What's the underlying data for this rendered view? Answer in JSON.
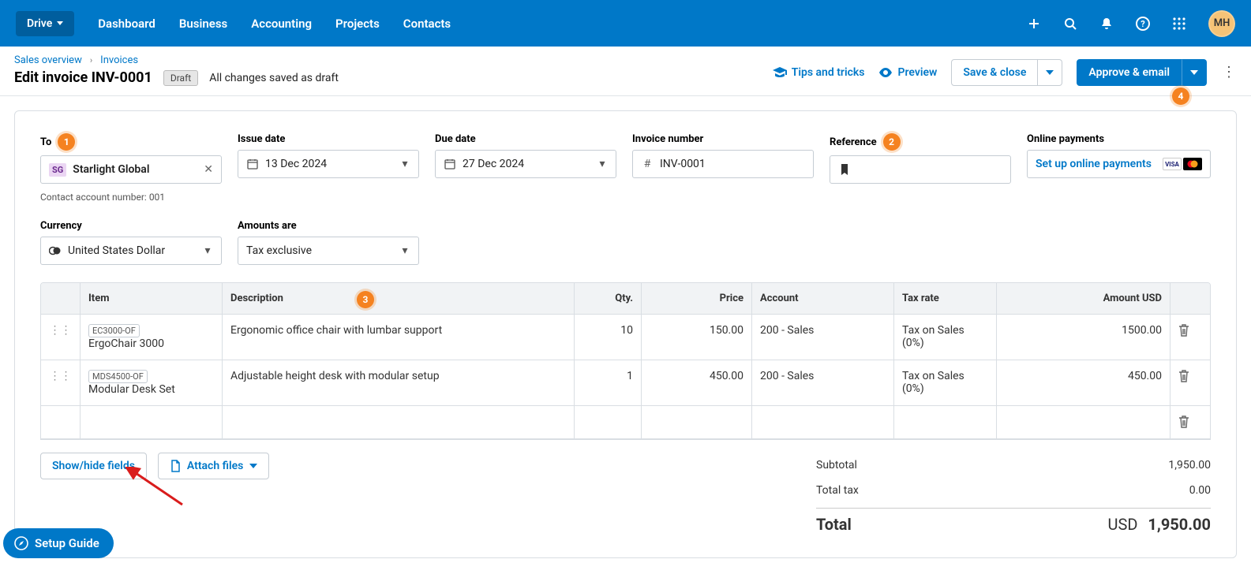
{
  "top": {
    "org": "Drive",
    "nav": [
      "Dashboard",
      "Business",
      "Accounting",
      "Projects",
      "Contacts"
    ],
    "avatar_initials": "MH"
  },
  "breadcrumb": {
    "a": "Sales overview",
    "b": "Invoices"
  },
  "page_title": "Edit invoice INV-0001",
  "status_badge": "Draft",
  "save_msg": "All changes saved as draft",
  "actions": {
    "tips": "Tips and tricks",
    "preview": "Preview",
    "save_close": "Save & close",
    "approve_email": "Approve & email"
  },
  "callouts": {
    "c1": "1",
    "c2": "2",
    "c3": "3",
    "c4": "4"
  },
  "fields": {
    "to_label": "To",
    "contact_chip": "SG",
    "contact_name": "Starlight Global",
    "contact_helper": "Contact account number: 001",
    "issue_label": "Issue date",
    "issue_val": "13 Dec 2024",
    "due_label": "Due date",
    "due_val": "27 Dec 2024",
    "invno_label": "Invoice number",
    "invno_val": "INV-0001",
    "ref_label": "Reference",
    "pay_label": "Online payments",
    "pay_link": "Set up online payments",
    "cur_label": "Currency",
    "cur_val": "United States Dollar",
    "amt_label": "Amounts are",
    "amt_val": "Tax exclusive"
  },
  "cols": {
    "item": "Item",
    "desc": "Description",
    "qty": "Qty.",
    "price": "Price",
    "acct": "Account",
    "tax": "Tax rate",
    "amt": "Amount USD"
  },
  "lines": [
    {
      "sku": "EC3000-OF",
      "item": "ErgoChair 3000",
      "desc": "Ergonomic office chair with lumbar support",
      "qty": "10",
      "price": "150.00",
      "acct": "200 - Sales",
      "tax": "Tax on Sales (0%)",
      "amt": "1500.00"
    },
    {
      "sku": "MDS4500-OF",
      "item": "Modular Desk Set",
      "desc": "Adjustable height desk with modular setup",
      "qty": "1",
      "price": "450.00",
      "acct": "200 - Sales",
      "tax": "Tax on Sales (0%)",
      "amt": "450.00"
    }
  ],
  "below": {
    "showhide": "Show/hide fields",
    "attach": "Attach files"
  },
  "totals": {
    "subtotal_l": "Subtotal",
    "subtotal_v": "1,950.00",
    "tax_l": "Total tax",
    "tax_v": "0.00",
    "total_l": "Total",
    "total_curr": "USD",
    "total_v": "1,950.00"
  },
  "setup_guide": "Setup Guide"
}
